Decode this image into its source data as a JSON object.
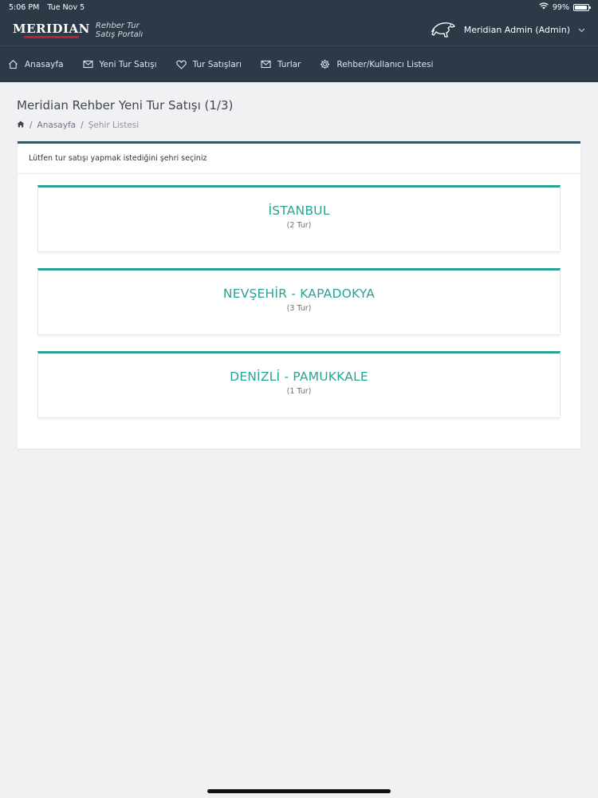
{
  "status_bar": {
    "time": "5:06 PM",
    "date": "Tue Nov 5",
    "battery": "99%",
    "battery_level": 0.99
  },
  "brand": {
    "logo_text": "MERIDIAN",
    "subtitle_line1": "Rehber Tur",
    "subtitle_line2": "Satış Portalı"
  },
  "user": {
    "name": "Meridian Admin (Admin)"
  },
  "nav": {
    "items": [
      {
        "label": "Anasayfa",
        "icon": "home-icon"
      },
      {
        "label": "Yeni Tur Satışı",
        "icon": "envelope-icon"
      },
      {
        "label": "Tur Satışları",
        "icon": "heart-icon"
      },
      {
        "label": "Turlar",
        "icon": "envelope-icon"
      },
      {
        "label": "Rehber/Kullanıcı Listesi",
        "icon": "gear-icon"
      }
    ]
  },
  "page": {
    "title": "Meridian Rehber Yeni Tur Satışı (1/3)",
    "breadcrumb": {
      "home": "Anasayfa",
      "current": "Şehir Listesi"
    }
  },
  "panel": {
    "instruction": "Lütfen tur satışı yapmak istediğini şehri seçiniz",
    "cities": [
      {
        "name": "İSTANBUL",
        "count": "(2 Tur)"
      },
      {
        "name": "NEVŞEHİR - KAPADOKYA",
        "count": "(3 Tur)"
      },
      {
        "name": "DENİZLİ - PAMUKKALE",
        "count": "(1 Tur)"
      }
    ]
  },
  "colors": {
    "navbar": "#2c3947",
    "accent": "#2aa394",
    "panel_border": "#1e5f74",
    "background": "#f1f1f4"
  }
}
